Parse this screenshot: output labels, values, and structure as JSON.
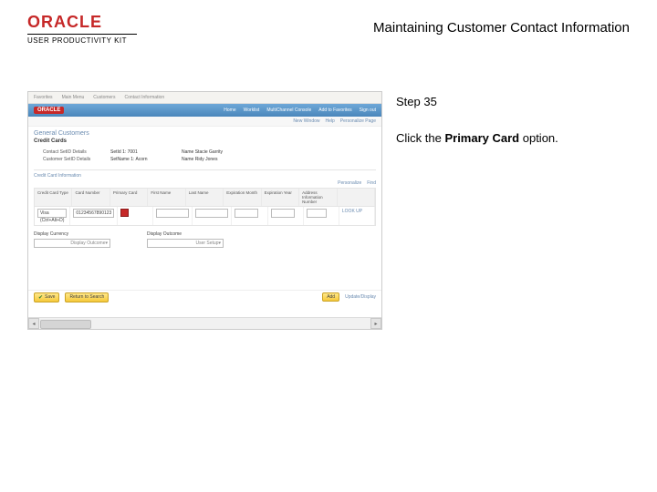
{
  "logo": {
    "brand": "ORACLE",
    "kit": "USER PRODUCTIVITY KIT"
  },
  "doc_title": "Maintaining Customer Contact Information",
  "instruction": {
    "step": "Step 35",
    "pre": "Click the ",
    "bold": "Primary Card",
    "post": " option."
  },
  "ss": {
    "tabs": [
      "Favorites",
      "Main Menu",
      "Customers",
      "Contact Information"
    ],
    "brand": "ORACLE",
    "topnav": [
      "Home",
      "Worklist",
      "MultiChannel Console",
      "Add to Favorites",
      "Sign out"
    ],
    "subnav": [
      "New Window",
      "Help",
      "Personalize Page"
    ],
    "h1": "General Customers",
    "h2": "Credit Cards",
    "rows": [
      {
        "l1": "Contact SetID Details",
        "v1": "SetId 1: 7001",
        "l2": "Name  Stacie Garrity"
      },
      {
        "l1": "Customer SetID Details",
        "v1": "SetName 1: Acorn",
        "l2": "Name  Ridy Jones"
      }
    ],
    "section": "Credit Card Information",
    "tools": [
      "Personalize",
      "Find"
    ],
    "cols": [
      "Credit Card Type",
      "Card Number",
      "Primary Card",
      "First Name",
      "Last Name",
      "Expiration Month",
      "Expiration Year",
      "Address Information Number",
      ""
    ],
    "row1": {
      "type": "Visa  (Ctrl+Alt+D)",
      "num": "01234567890123",
      "last": "LOOK UP"
    },
    "dd": [
      {
        "lbl": "Display Currency",
        "val": "Display Outcome"
      },
      {
        "lbl": "Display Outcome",
        "val": "User Setup"
      }
    ],
    "save": "Save",
    "rtn": "Return to Search",
    "add": "Add",
    "lnk": "Update/Display"
  }
}
